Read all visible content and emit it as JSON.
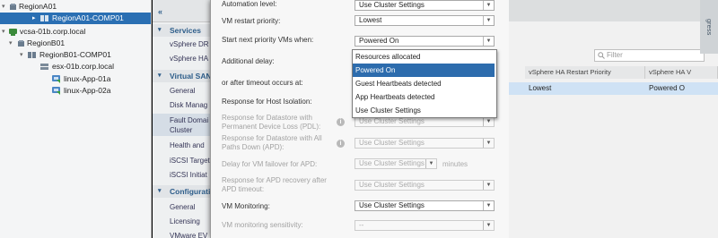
{
  "tree": {
    "items": [
      {
        "label": "RegionA01"
      },
      {
        "label": "RegionA01-COMP01"
      },
      {
        "label": "vcsa-01b.corp.local"
      },
      {
        "label": "RegionB01"
      },
      {
        "label": "RegionB01-COMP01"
      },
      {
        "label": "esx-01b.corp.local"
      },
      {
        "label": "linux-App-01a"
      },
      {
        "label": "linux-App-02a"
      }
    ]
  },
  "nav": {
    "sections": [
      {
        "label": "Services",
        "items": [
          "vSphere DR",
          "vSphere HA"
        ]
      },
      {
        "label": "Virtual SAN",
        "items": [
          "General",
          "Disk Manag",
          "Fault Domai Cluster",
          "Health and",
          "iSCSI Target",
          "iSCSI Initiat"
        ]
      },
      {
        "label": "Configuratio",
        "items": [
          "General",
          "Licensing",
          "VMware EV"
        ]
      }
    ]
  },
  "dialog": {
    "fields": [
      {
        "label": "Automation level:",
        "value": "Use Cluster Settings"
      },
      {
        "label": "VM restart priority:",
        "value": "Lowest"
      },
      {
        "label": "Start next priority VMs when:",
        "value": "Powered On"
      },
      {
        "label": "Additional delay:"
      },
      {
        "label": "or after timeout occurs at:"
      },
      {
        "label": "Response for Host Isolation:"
      },
      {
        "label": "Response for Datastore with Permanent Device Loss (PDL):",
        "value": "Use Cluster Settings"
      },
      {
        "label": "Response for Datastore with All Paths Down (APD):",
        "value": "Use Cluster Settings"
      },
      {
        "label": "Delay for VM failover for APD:",
        "value": "Use Cluster Settings",
        "unit": "minutes"
      },
      {
        "label": "Response for APD recovery after APD timeout:",
        "value": "Use Cluster Settings"
      },
      {
        "label": "VM Monitoring:",
        "value": "Use Cluster Settings"
      },
      {
        "label": "VM monitoring sensitivity:",
        "value": "--"
      }
    ]
  },
  "dropdown": {
    "options": [
      "Resources allocated",
      "Powered On",
      "Guest Heartbeats detected",
      "App Heartbeats detected",
      "Use Cluster Settings"
    ],
    "highlighted": "Powered On"
  },
  "right": {
    "filter_placeholder": "Filter",
    "columns": [
      "vSphere HA Restart Priority",
      "vSphere HA V"
    ],
    "row": [
      "Lowest",
      "Powered O"
    ],
    "progress_label": "gress"
  },
  "icons": {
    "folder": "folder-icon",
    "cluster": "cluster-icon",
    "vcenter": "vcenter-icon",
    "datacenter": "datacenter-icon",
    "host": "host-icon",
    "vm": "vm-icon",
    "info": "info-icon",
    "search": "search-icon"
  },
  "colors": {
    "selection": "#2a6fb3",
    "highlight": "#2d6cad",
    "nav_section": "#2d5d8a"
  }
}
